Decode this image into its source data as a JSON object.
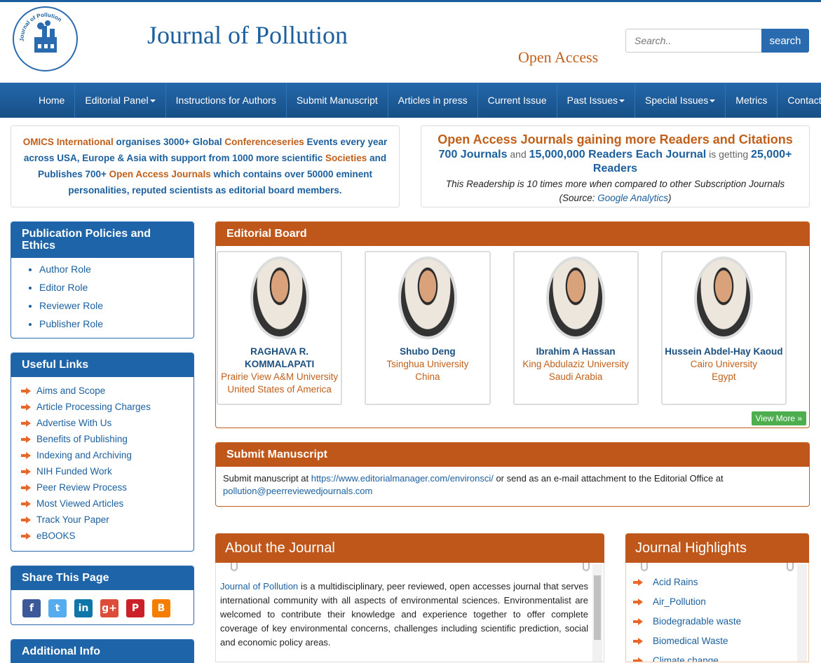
{
  "header": {
    "title": "Journal of Pollution",
    "subtitle": "Open Access",
    "logo_text": "Journal of Pollution",
    "search": {
      "placeholder": "Search..",
      "button": "search"
    }
  },
  "nav": [
    {
      "label": "Home",
      "dropdown": false
    },
    {
      "label": "Editorial Panel",
      "dropdown": true
    },
    {
      "label": "Instructions for Authors",
      "dropdown": false
    },
    {
      "label": "Submit Manuscript",
      "dropdown": false
    },
    {
      "label": "Articles in press",
      "dropdown": false
    },
    {
      "label": "Current Issue",
      "dropdown": false
    },
    {
      "label": "Past Issues",
      "dropdown": true
    },
    {
      "label": "Special Issues",
      "dropdown": true
    },
    {
      "label": "Metrics",
      "dropdown": false
    },
    {
      "label": "Contact",
      "dropdown": false
    }
  ],
  "omics": {
    "p1": "OMICS International",
    "p2": " organises 3000+ Global ",
    "p3": "Conferenceseries",
    "p4": " Events every year across USA, Europe & Asia with support from 1000 more scientific ",
    "p5": "Societies",
    "p6": " and Publishes 700+ ",
    "p7": "Open Access Journals",
    "p8": " which contains over 50000 eminent personalities, reputed scientists as editorial board members."
  },
  "oaj": {
    "heading": "Open Access Journals gaining more Readers and Citations",
    "l2a": "700 Journals",
    "l2b": " and ",
    "l2c": "15,000,000 Readers Each Journal",
    "l2d": " is getting ",
    "l2e": "25,000+ Readers",
    "l3a": "This Readership is 10 times more when compared to other Subscription Journals (Source: ",
    "l3b": "Google Analytics",
    "l3c": ")"
  },
  "policies": {
    "title": "Publication Policies and Ethics",
    "items": [
      "Author Role",
      "Editor Role",
      "Reviewer Role",
      "Publisher Role"
    ]
  },
  "useful_links": {
    "title": "Useful Links",
    "items": [
      "Aims and Scope",
      "Article Processing Charges",
      "Advertise With Us",
      "Benefits of Publishing",
      "Indexing and Archiving",
      "NIH Funded Work",
      "Peer Review Process",
      "Most Viewed Articles",
      "Track Your Paper",
      "eBOOKS"
    ]
  },
  "share": {
    "title": "Share This Page",
    "icons": [
      {
        "name": "facebook-icon",
        "glyph": "f",
        "color": "#3b5998"
      },
      {
        "name": "twitter-icon",
        "glyph": "t",
        "color": "#55acee"
      },
      {
        "name": "linkedin-icon",
        "glyph": "in",
        "color": "#0e76a8"
      },
      {
        "name": "googleplus-icon",
        "glyph": "g+",
        "color": "#dd4b39"
      },
      {
        "name": "pinterest-icon",
        "glyph": "P",
        "color": "#cb2027"
      },
      {
        "name": "blogger-icon",
        "glyph": "B",
        "color": "#f57d00"
      }
    ]
  },
  "additional": {
    "title": "Additional Info"
  },
  "editorial": {
    "title": "Editorial Board",
    "members": [
      {
        "name": "RAGHAVA R. KOMMALAPATI",
        "aff1": "Prairie View A&M University",
        "aff2": "United States of America"
      },
      {
        "name": "Shubo Deng",
        "aff1": "Tsinghua University",
        "aff2": "China"
      },
      {
        "name": "Ibrahim A Hassan",
        "aff1": "King Abdulaziz University",
        "aff2": "Saudi Arabia"
      },
      {
        "name": "Hussein Abdel-Hay Kaoud",
        "aff1": "Cairo University",
        "aff2": "Egypt"
      }
    ],
    "view_more": "View More »"
  },
  "submit": {
    "title": "Submit Manuscript",
    "t1": "Submit manuscript at ",
    "link": "https://www.editorialmanager.com/environsci/",
    "t2": " or send as an e-mail attachment to the Editorial Office at ",
    "email": "pollution@peerreviewedjournals.com"
  },
  "about": {
    "title": "About the Journal",
    "journal_name": "Journal of Pollution",
    "text": " is a multidisciplinary, peer reviewed, open accesses journal that serves international community with all aspects of environmental sciences. Environmentalist are welcomed to contribute their knowledge and experience together to offer complete coverage of key environmental concerns, challenges including scientific prediction, social and economic policy areas."
  },
  "highlights": {
    "title": "Journal Highlights",
    "items": [
      "Acid Rains",
      "Air_Pollution",
      "Biodegradable waste",
      "Biomedical Waste",
      "Climate  change"
    ]
  }
}
